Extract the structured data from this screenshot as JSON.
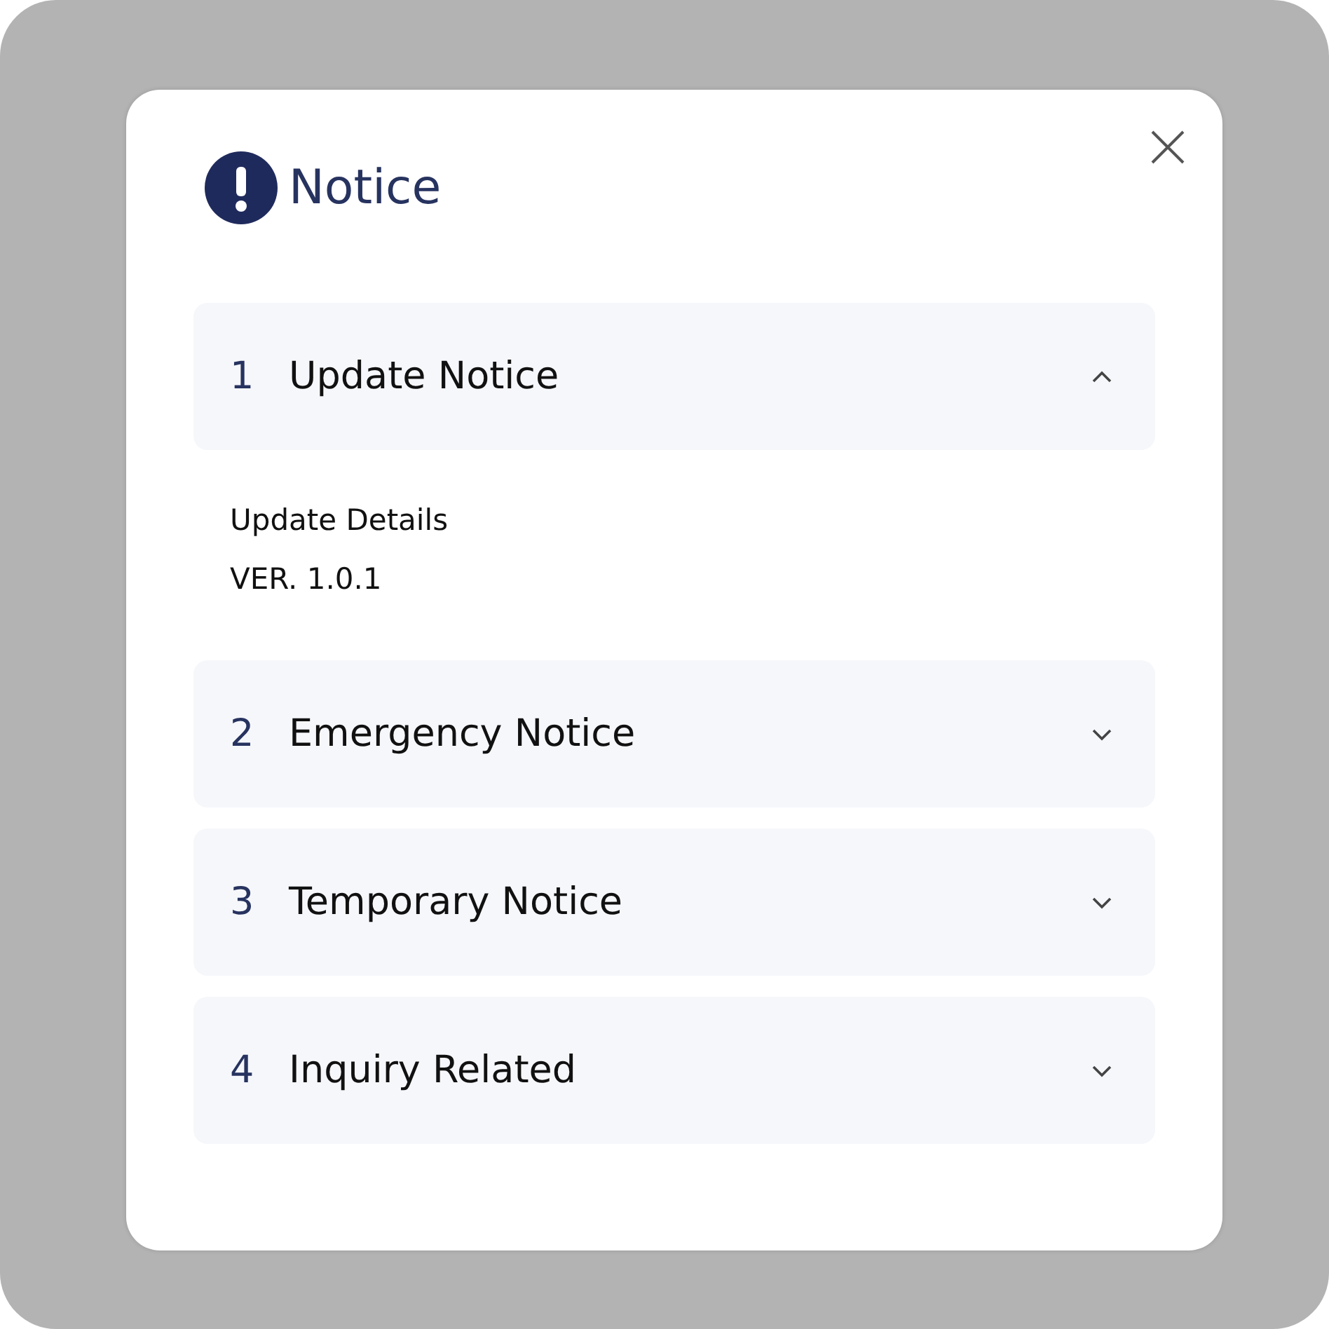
{
  "dialog": {
    "title": "Notice"
  },
  "sections": [
    {
      "number": "1",
      "title": "Update Notice",
      "expanded": true,
      "content": [
        "Update Details",
        "VER. 1.0.1"
      ]
    },
    {
      "number": "2",
      "title": "Emergency Notice",
      "expanded": false
    },
    {
      "number": "3",
      "title": "Temporary Notice",
      "expanded": false
    },
    {
      "number": "4",
      "title": "Inquiry Related",
      "expanded": false
    }
  ]
}
